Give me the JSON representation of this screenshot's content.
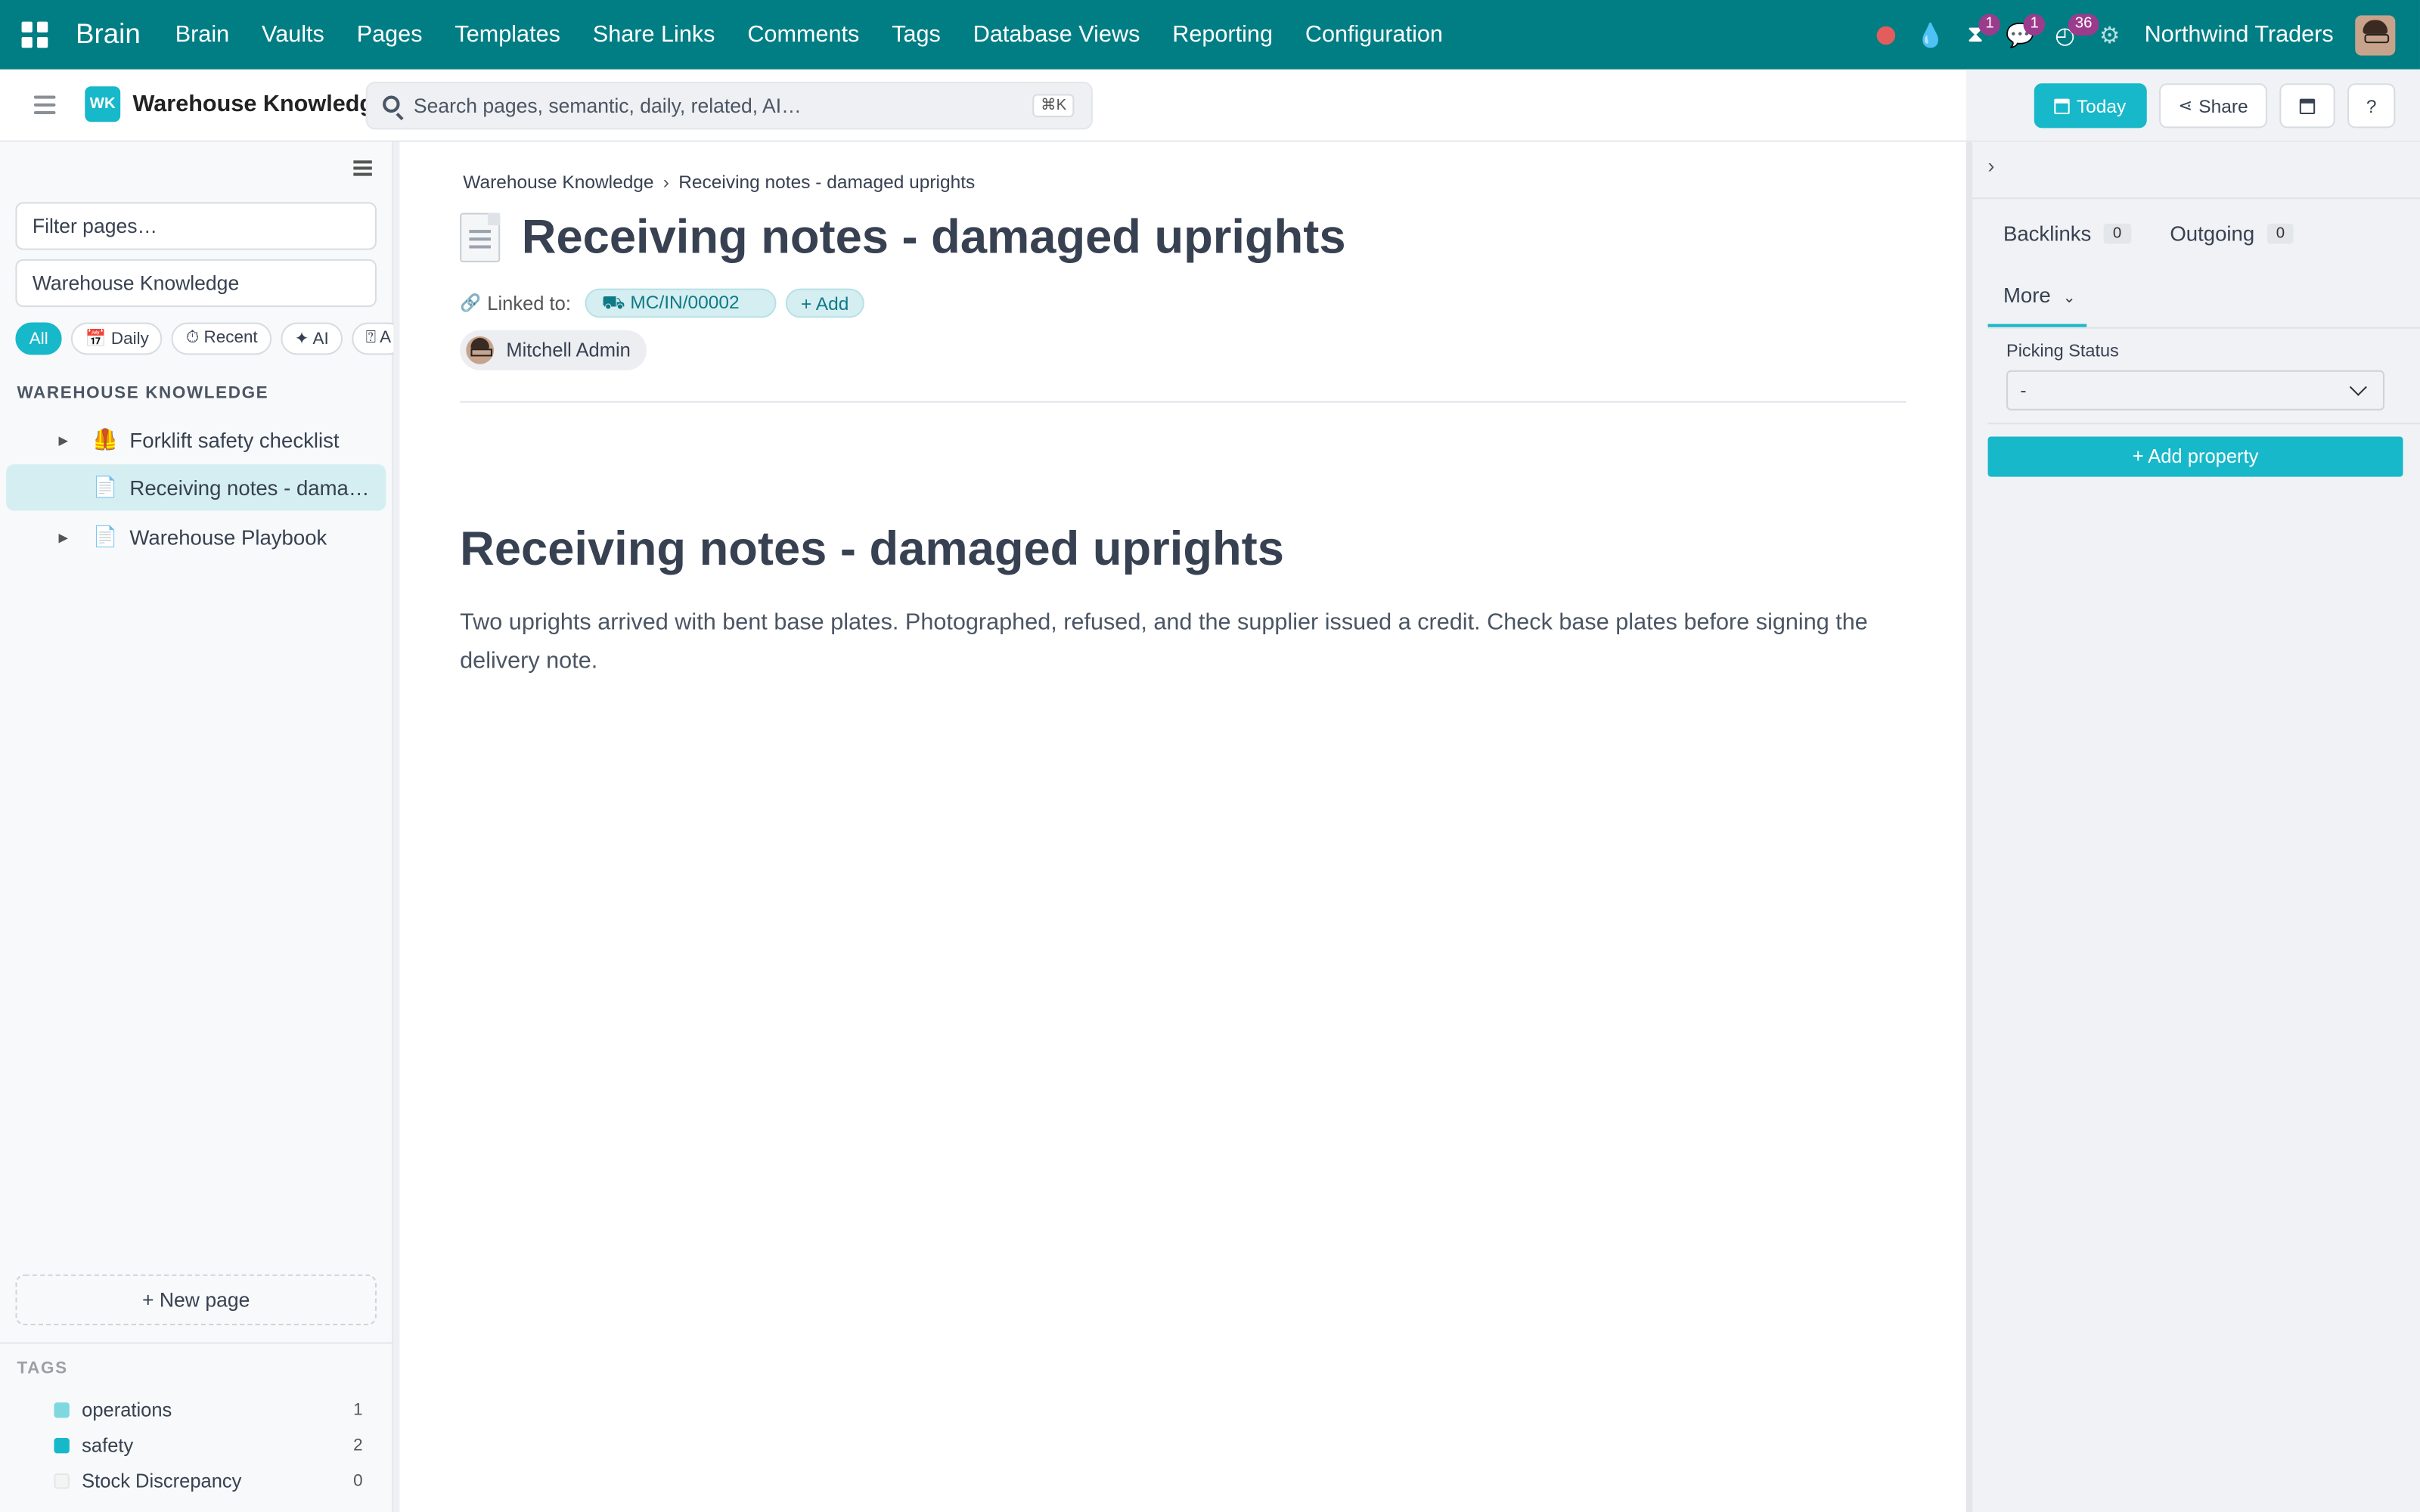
{
  "topnav": {
    "brand": "Brain",
    "menu": [
      "Brain",
      "Vaults",
      "Pages",
      "Templates",
      "Share Links",
      "Comments",
      "Tags",
      "Database Views",
      "Reporting",
      "Configuration"
    ],
    "badges": {
      "activity": "1",
      "messages": "1",
      "clock": "36"
    },
    "company": "Northwind Traders"
  },
  "controlbar": {
    "vault_badge": "WK",
    "vault_name": "Warehouse Knowledge",
    "search_placeholder": "Search pages, semantic, daily, related, AI…",
    "search_shortcut": "⌘K",
    "today_label": "Today",
    "share_label": "Share",
    "help_label": "?"
  },
  "sidebar": {
    "filter_placeholder": "Filter pages…",
    "vault_select": "Warehouse Knowledge",
    "chips": [
      "All",
      "📅 Daily",
      "⏱ Recent",
      "✦ AI",
      "⍰ A"
    ],
    "section_title": "WAREHOUSE KNOWLEDGE",
    "pages": [
      {
        "label": "Forklift safety checklist",
        "icon": "🦺"
      },
      {
        "label": "Receiving notes - damaged uprights",
        "icon": "📄"
      },
      {
        "label": "Warehouse Playbook",
        "icon": "📄"
      }
    ],
    "new_page": "+ New page",
    "tags_title": "TAGS",
    "tags": [
      {
        "name": "operations",
        "count": "1",
        "color": "#7fd8df"
      },
      {
        "name": "safety",
        "count": "2",
        "color": "#17b8c9"
      },
      {
        "name": "Stock Discrepancy",
        "count": "0",
        "color": "#f4f4f4"
      }
    ]
  },
  "main": {
    "breadcrumb": [
      "Warehouse Knowledge",
      "›",
      "Receiving notes - damaged uprights"
    ],
    "title": "Receiving notes - damaged uprights",
    "linked_label": "Linked to:",
    "linked_record": "⛟ MC/IN/00002",
    "add_label": "+ Add",
    "owner": "Mitchell Admin",
    "heading": "Receiving notes - damaged uprights",
    "body": "Two uprights arrived with bent base plates. Photographed, refused, and the supplier issued a credit. Check base plates before signing the delivery note."
  },
  "rightpanel": {
    "backlinks_label": "Backlinks",
    "backlinks_count": "0",
    "outgoing_label": "Outgoing",
    "outgoing_count": "0",
    "more_label": "More",
    "property_label": "Picking Status",
    "property_value": "-",
    "add_property": "+ Add property"
  },
  "colors": {
    "navbar": "#017e84",
    "accent": "#17b8c9"
  }
}
